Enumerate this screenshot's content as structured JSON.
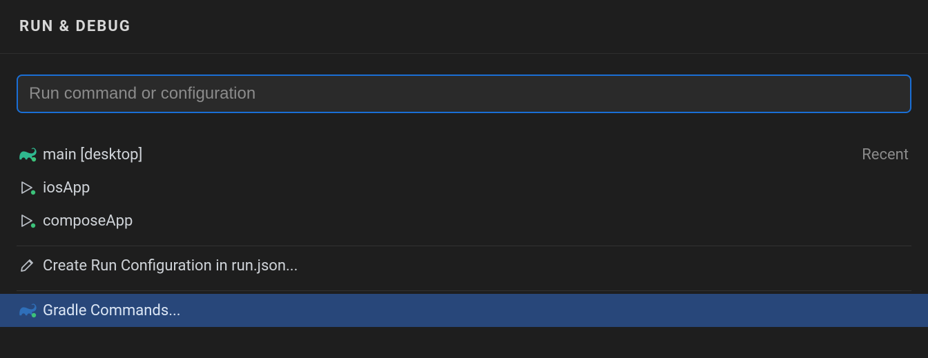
{
  "header": {
    "title": "RUN & DEBUG"
  },
  "search": {
    "placeholder": "Run command or configuration",
    "value": ""
  },
  "recent_label": "Recent",
  "configs": [
    {
      "label": "main [desktop]",
      "icon": "gradle",
      "recent": true
    },
    {
      "label": "iosApp",
      "icon": "play",
      "recent": false
    },
    {
      "label": "composeApp",
      "icon": "play",
      "recent": false
    }
  ],
  "create_config": {
    "label": "Create Run Configuration in run.json..."
  },
  "gradle_commands": {
    "label": "Gradle Commands..."
  }
}
